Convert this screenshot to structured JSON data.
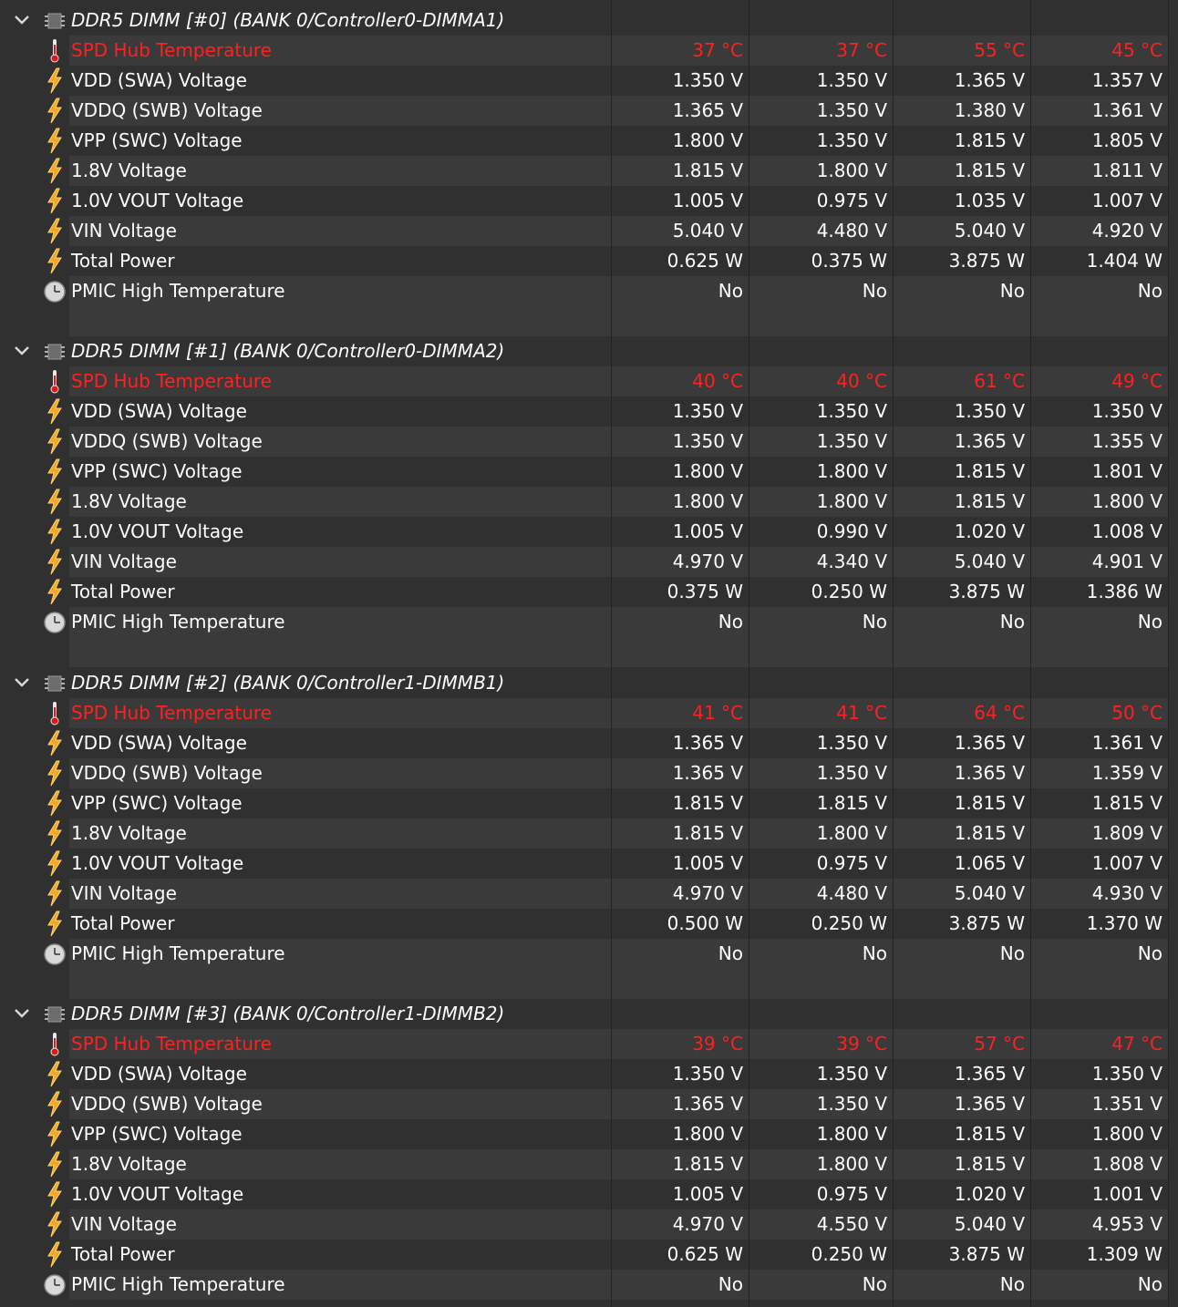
{
  "colors": {
    "alarm": "#ff2020",
    "text": "#ffffff",
    "row_alt": "#3a3a3a",
    "row_base": "#303030"
  },
  "groups": [
    {
      "title": "DDR5 DIMM [#0] (BANK 0/Controller0-DIMMA1)",
      "rows": [
        {
          "label": "SPD Hub Temperature",
          "icon": "thermometer-icon",
          "alarm": true,
          "values": [
            "37 °C",
            "37 °C",
            "55 °C",
            "45 °C"
          ]
        },
        {
          "label": "VDD (SWA) Voltage",
          "icon": "lightning-icon",
          "values": [
            "1.350 V",
            "1.350 V",
            "1.365 V",
            "1.357 V"
          ]
        },
        {
          "label": "VDDQ (SWB) Voltage",
          "icon": "lightning-icon",
          "values": [
            "1.365 V",
            "1.350 V",
            "1.380 V",
            "1.361 V"
          ]
        },
        {
          "label": "VPP (SWC) Voltage",
          "icon": "lightning-icon",
          "values": [
            "1.800 V",
            "1.350 V",
            "1.815 V",
            "1.805 V"
          ]
        },
        {
          "label": "1.8V Voltage",
          "icon": "lightning-icon",
          "values": [
            "1.815 V",
            "1.800 V",
            "1.815 V",
            "1.811 V"
          ]
        },
        {
          "label": "1.0V VOUT Voltage",
          "icon": "lightning-icon",
          "values": [
            "1.005 V",
            "0.975 V",
            "1.035 V",
            "1.007 V"
          ]
        },
        {
          "label": "VIN Voltage",
          "icon": "lightning-icon",
          "values": [
            "5.040 V",
            "4.480 V",
            "5.040 V",
            "4.920 V"
          ]
        },
        {
          "label": "Total Power",
          "icon": "lightning-icon",
          "values": [
            "0.625 W",
            "0.375 W",
            "3.875 W",
            "1.404 W"
          ]
        },
        {
          "label": "PMIC High Temperature",
          "icon": "clock-icon",
          "values": [
            "No",
            "No",
            "No",
            "No"
          ]
        }
      ]
    },
    {
      "title": "DDR5 DIMM [#1] (BANK 0/Controller0-DIMMA2)",
      "rows": [
        {
          "label": "SPD Hub Temperature",
          "icon": "thermometer-icon",
          "alarm": true,
          "values": [
            "40 °C",
            "40 °C",
            "61 °C",
            "49 °C"
          ]
        },
        {
          "label": "VDD (SWA) Voltage",
          "icon": "lightning-icon",
          "values": [
            "1.350 V",
            "1.350 V",
            "1.350 V",
            "1.350 V"
          ]
        },
        {
          "label": "VDDQ (SWB) Voltage",
          "icon": "lightning-icon",
          "values": [
            "1.350 V",
            "1.350 V",
            "1.365 V",
            "1.355 V"
          ]
        },
        {
          "label": "VPP (SWC) Voltage",
          "icon": "lightning-icon",
          "values": [
            "1.800 V",
            "1.800 V",
            "1.815 V",
            "1.801 V"
          ]
        },
        {
          "label": "1.8V Voltage",
          "icon": "lightning-icon",
          "values": [
            "1.800 V",
            "1.800 V",
            "1.815 V",
            "1.800 V"
          ]
        },
        {
          "label": "1.0V VOUT Voltage",
          "icon": "lightning-icon",
          "values": [
            "1.005 V",
            "0.990 V",
            "1.020 V",
            "1.008 V"
          ]
        },
        {
          "label": "VIN Voltage",
          "icon": "lightning-icon",
          "values": [
            "4.970 V",
            "4.340 V",
            "5.040 V",
            "4.901 V"
          ]
        },
        {
          "label": "Total Power",
          "icon": "lightning-icon",
          "values": [
            "0.375 W",
            "0.250 W",
            "3.875 W",
            "1.386 W"
          ]
        },
        {
          "label": "PMIC High Temperature",
          "icon": "clock-icon",
          "values": [
            "No",
            "No",
            "No",
            "No"
          ]
        }
      ]
    },
    {
      "title": "DDR5 DIMM [#2] (BANK 0/Controller1-DIMMB1)",
      "rows": [
        {
          "label": "SPD Hub Temperature",
          "icon": "thermometer-icon",
          "alarm": true,
          "values": [
            "41 °C",
            "41 °C",
            "64 °C",
            "50 °C"
          ]
        },
        {
          "label": "VDD (SWA) Voltage",
          "icon": "lightning-icon",
          "values": [
            "1.365 V",
            "1.350 V",
            "1.365 V",
            "1.361 V"
          ]
        },
        {
          "label": "VDDQ (SWB) Voltage",
          "icon": "lightning-icon",
          "values": [
            "1.365 V",
            "1.350 V",
            "1.365 V",
            "1.359 V"
          ]
        },
        {
          "label": "VPP (SWC) Voltage",
          "icon": "lightning-icon",
          "values": [
            "1.815 V",
            "1.815 V",
            "1.815 V",
            "1.815 V"
          ]
        },
        {
          "label": "1.8V Voltage",
          "icon": "lightning-icon",
          "values": [
            "1.815 V",
            "1.800 V",
            "1.815 V",
            "1.809 V"
          ]
        },
        {
          "label": "1.0V VOUT Voltage",
          "icon": "lightning-icon",
          "values": [
            "1.005 V",
            "0.975 V",
            "1.065 V",
            "1.007 V"
          ]
        },
        {
          "label": "VIN Voltage",
          "icon": "lightning-icon",
          "values": [
            "4.970 V",
            "4.480 V",
            "5.040 V",
            "4.930 V"
          ]
        },
        {
          "label": "Total Power",
          "icon": "lightning-icon",
          "values": [
            "0.500 W",
            "0.250 W",
            "3.875 W",
            "1.370 W"
          ]
        },
        {
          "label": "PMIC High Temperature",
          "icon": "clock-icon",
          "values": [
            "No",
            "No",
            "No",
            "No"
          ]
        }
      ]
    },
    {
      "title": "DDR5 DIMM [#3] (BANK 0/Controller1-DIMMB2)",
      "rows": [
        {
          "label": "SPD Hub Temperature",
          "icon": "thermometer-icon",
          "alarm": true,
          "values": [
            "39 °C",
            "39 °C",
            "57 °C",
            "47 °C"
          ]
        },
        {
          "label": "VDD (SWA) Voltage",
          "icon": "lightning-icon",
          "values": [
            "1.350 V",
            "1.350 V",
            "1.365 V",
            "1.350 V"
          ]
        },
        {
          "label": "VDDQ (SWB) Voltage",
          "icon": "lightning-icon",
          "values": [
            "1.365 V",
            "1.350 V",
            "1.365 V",
            "1.351 V"
          ]
        },
        {
          "label": "VPP (SWC) Voltage",
          "icon": "lightning-icon",
          "values": [
            "1.800 V",
            "1.800 V",
            "1.815 V",
            "1.800 V"
          ]
        },
        {
          "label": "1.8V Voltage",
          "icon": "lightning-icon",
          "values": [
            "1.815 V",
            "1.800 V",
            "1.815 V",
            "1.808 V"
          ]
        },
        {
          "label": "1.0V VOUT Voltage",
          "icon": "lightning-icon",
          "values": [
            "1.005 V",
            "0.975 V",
            "1.020 V",
            "1.001 V"
          ]
        },
        {
          "label": "VIN Voltage",
          "icon": "lightning-icon",
          "values": [
            "4.970 V",
            "4.550 V",
            "5.040 V",
            "4.953 V"
          ]
        },
        {
          "label": "Total Power",
          "icon": "lightning-icon",
          "values": [
            "0.625 W",
            "0.250 W",
            "3.875 W",
            "1.309 W"
          ]
        },
        {
          "label": "PMIC High Temperature",
          "icon": "clock-icon",
          "values": [
            "No",
            "No",
            "No",
            "No"
          ]
        }
      ]
    }
  ]
}
